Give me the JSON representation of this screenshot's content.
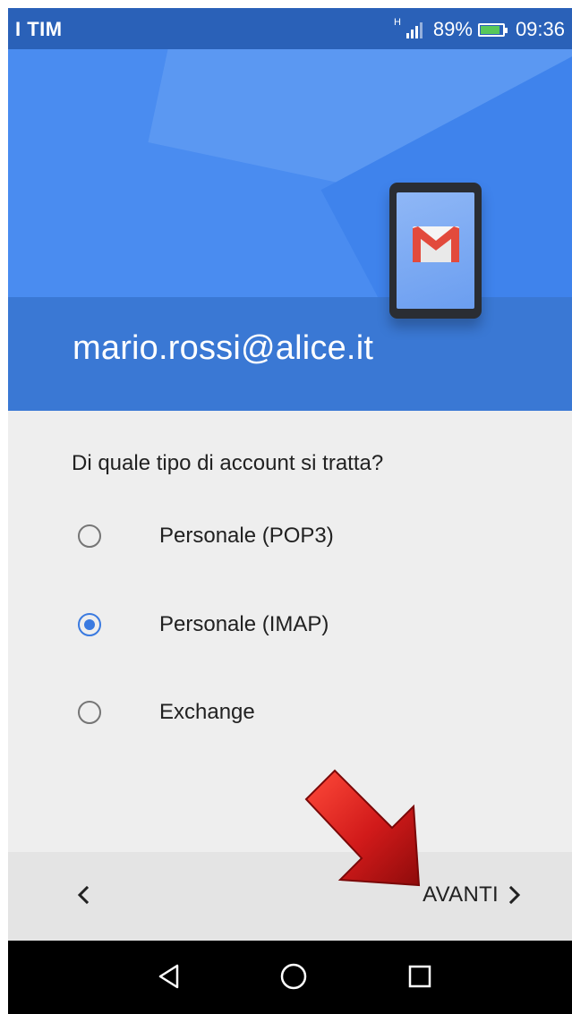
{
  "status_bar": {
    "carrier": "I TIM",
    "network": "H",
    "battery_percent": "89%",
    "battery_level": 0.89,
    "time": "09:36"
  },
  "header": {
    "email": "mario.rossi@alice.it",
    "illustration_icon": "gmail-phone-icon"
  },
  "form": {
    "question": "Di quale tipo di account si tratta?",
    "options": [
      {
        "label": "Personale (POP3)",
        "selected": false
      },
      {
        "label": "Personale (IMAP)",
        "selected": true
      },
      {
        "label": "Exchange",
        "selected": false
      }
    ]
  },
  "footer": {
    "back_icon": "chevron-left-icon",
    "next_label": "AVANTI",
    "next_icon": "chevron-right-icon"
  },
  "annotation": {
    "icon": "red-arrow-icon",
    "color": "#d11a1a"
  },
  "system_nav": {
    "back_icon": "triangle-back-icon",
    "home_icon": "circle-home-icon",
    "recents_icon": "square-recents-icon"
  },
  "colors": {
    "accent": "#3a7ae0",
    "header_blue": "#4a8cf0",
    "header_band": "#3a78d4",
    "status_bar": "#2a61b8"
  }
}
